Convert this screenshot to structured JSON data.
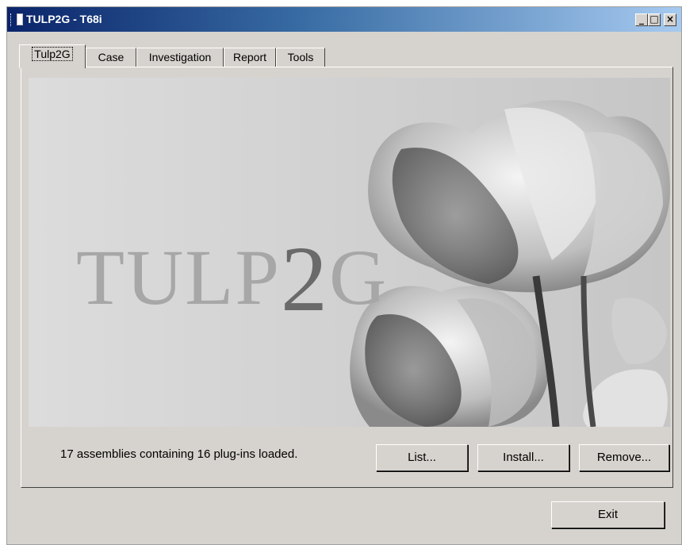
{
  "window": {
    "title": "TULP2G - T68i",
    "controls": {
      "minimize": "_",
      "maximize": "□",
      "close": "×"
    }
  },
  "tabs": [
    {
      "label": "Tulp2G",
      "active": true
    },
    {
      "label": "Case",
      "active": false
    },
    {
      "label": "Investigation",
      "active": false
    },
    {
      "label": "Report",
      "active": false
    },
    {
      "label": "Tools",
      "active": false
    }
  ],
  "banner": {
    "logo_prefix": "TULP",
    "logo_two": "2",
    "logo_suffix": "G"
  },
  "status_text": "17 assemblies containing 16 plug-ins loaded.",
  "buttons": {
    "list": "List...",
    "install": "Install...",
    "remove": "Remove...",
    "exit": "Exit"
  },
  "colors": {
    "titlebar_start": "#0a246a",
    "titlebar_end": "#a6caf0",
    "window_bg": "#d6d3ce"
  }
}
